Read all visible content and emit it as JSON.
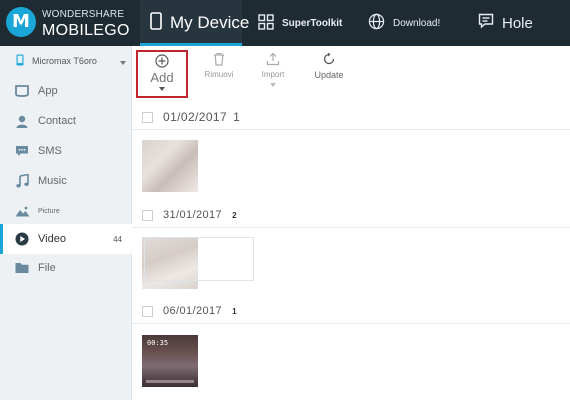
{
  "brand": {
    "line1": "WONDERSHARE",
    "line2": "MOBILEGO",
    "logo_letter": "M"
  },
  "top_tabs": [
    {
      "label": "My Device",
      "icon": "phone-icon",
      "active": true
    },
    {
      "label": "SuperToolkit",
      "icon": "grid-icon",
      "active": false
    },
    {
      "label": "Download!",
      "icon": "globe-icon",
      "active": false
    },
    {
      "label": "Hole",
      "icon": "chat-icon",
      "active": false
    }
  ],
  "sidebar": {
    "device_name": "Micromax T6oro",
    "items": [
      {
        "label": "App",
        "icon": "app-icon",
        "count": ""
      },
      {
        "label": "Contact",
        "icon": "contact-icon",
        "count": ""
      },
      {
        "label": "SMS",
        "icon": "sms-icon",
        "count": ""
      },
      {
        "label": "Music",
        "icon": "music-icon",
        "count": ""
      },
      {
        "label": "Picture",
        "icon": "picture-icon",
        "count": ""
      },
      {
        "label": "Video",
        "icon": "video-icon",
        "count": "44",
        "active": true
      },
      {
        "label": "File",
        "icon": "folder-icon",
        "count": ""
      }
    ]
  },
  "toolbar": {
    "add": "Add",
    "remove": "Rimuovi",
    "import": "Import",
    "update": "Update"
  },
  "groups": [
    {
      "date": "01/02/2017",
      "count": "1"
    },
    {
      "date": "31/01/2017",
      "count": "2"
    },
    {
      "date": "06/01/2017",
      "count": "1"
    }
  ],
  "thumbnails": {
    "video3_timestamp": "00:35"
  },
  "colors": {
    "topbar": "#1e2b33",
    "accent": "#1aa6d6",
    "highlight_box": "#c0262c",
    "sidebar": "#edf1f3"
  }
}
